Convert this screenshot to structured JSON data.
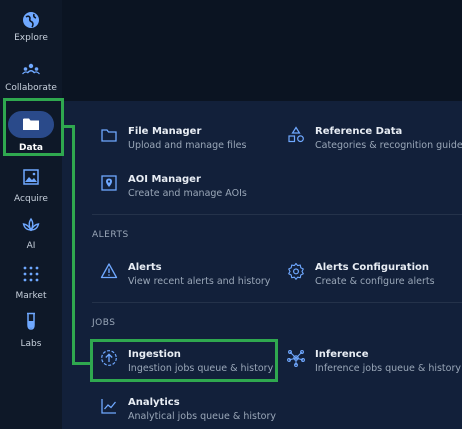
{
  "sidebar": {
    "items": [
      {
        "key": "explore",
        "label": "Explore",
        "icon": "globe-icon"
      },
      {
        "key": "collaborate",
        "label": "Collaborate",
        "icon": "users-icon"
      },
      {
        "key": "data",
        "label": "Data",
        "icon": "folder-icon",
        "active": true
      },
      {
        "key": "acquire",
        "label": "Acquire",
        "icon": "image-icon"
      },
      {
        "key": "ai",
        "label": "AI",
        "icon": "lotus-icon"
      },
      {
        "key": "market",
        "label": "Market",
        "icon": "grid-dots-icon"
      },
      {
        "key": "labs",
        "label": "Labs",
        "icon": "test-tube-icon"
      }
    ]
  },
  "menu": {
    "file_manager": {
      "title": "File Manager",
      "subtitle": "Upload and manage files",
      "icon": "folder-outline-icon"
    },
    "reference_data": {
      "title": "Reference Data",
      "subtitle": "Categories & recognition guides",
      "icon": "shapes-icon"
    },
    "aoi_manager": {
      "title": "AOI Manager",
      "subtitle": "Create and manage AOIs",
      "icon": "map-pin-icon"
    },
    "alerts_section": "ALERTS",
    "alerts": {
      "title": "Alerts",
      "subtitle": "View recent alerts and history",
      "icon": "warning-icon"
    },
    "alerts_configuration": {
      "title": "Alerts Configuration",
      "subtitle": "Create & configure alerts",
      "icon": "gear-icon"
    },
    "jobs_section": "JOBS",
    "ingestion": {
      "title": "Ingestion",
      "subtitle": "Ingestion jobs queue & history",
      "icon": "upload-circle-icon"
    },
    "inference": {
      "title": "Inference",
      "subtitle": "Inference jobs queue & history",
      "icon": "network-icon"
    },
    "analytics": {
      "title": "Analytics",
      "subtitle": "Analytical jobs queue & history",
      "icon": "chart-icon"
    }
  },
  "colors": {
    "highlight": "#2fa84f",
    "active_pill": "#2a4a8a",
    "icon": "#6fa8ff"
  }
}
